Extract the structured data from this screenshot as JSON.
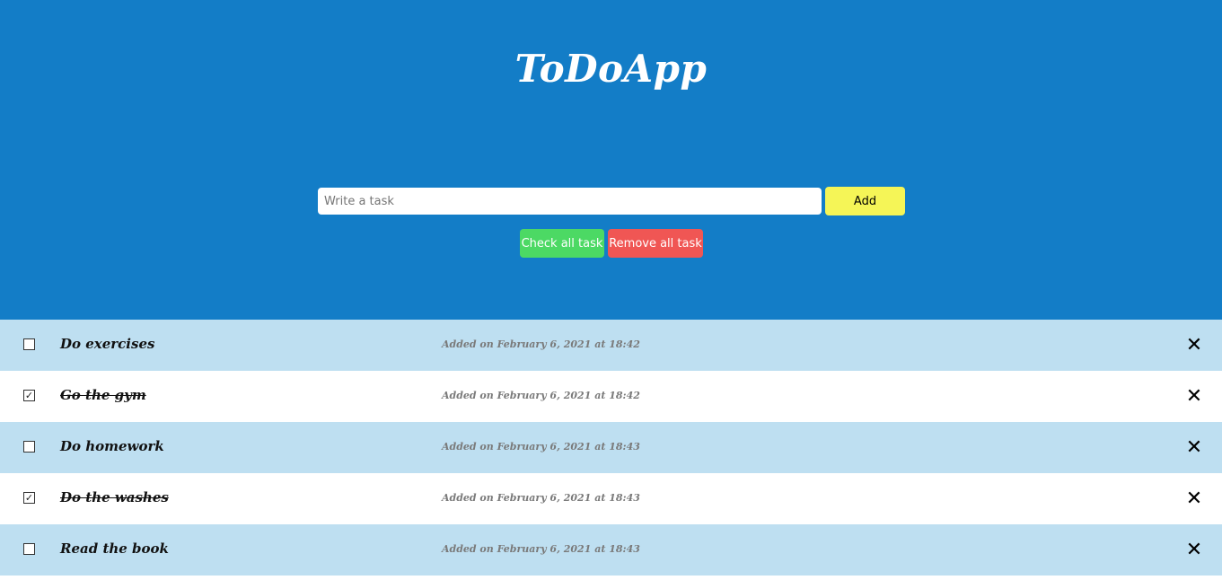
{
  "app": {
    "title": "ToDoApp"
  },
  "form": {
    "placeholder": "Write a task",
    "value": "",
    "add_label": "Add",
    "check_all_label": "Check all task",
    "remove_all_label": "Remove all task"
  },
  "colors": {
    "header_bg": "#137dc7",
    "add_btn": "#f5f557",
    "check_btn": "#4cd964",
    "remove_btn": "#f05654",
    "row_shaded": "#bedff1"
  },
  "icons": {
    "checked": "check-icon",
    "delete": "close-icon"
  },
  "tasks": [
    {
      "text": "Do exercises",
      "added": "Added on February 6, 2021 at 18:42",
      "done": false
    },
    {
      "text": "Go the gym",
      "added": "Added on February 6, 2021 at 18:42",
      "done": true
    },
    {
      "text": "Do homework",
      "added": "Added on February 6, 2021 at 18:43",
      "done": false
    },
    {
      "text": "Do the washes",
      "added": "Added on February 6, 2021 at 18:43",
      "done": true
    },
    {
      "text": "Read the book",
      "added": "Added on February 6, 2021 at 18:43",
      "done": false
    }
  ]
}
